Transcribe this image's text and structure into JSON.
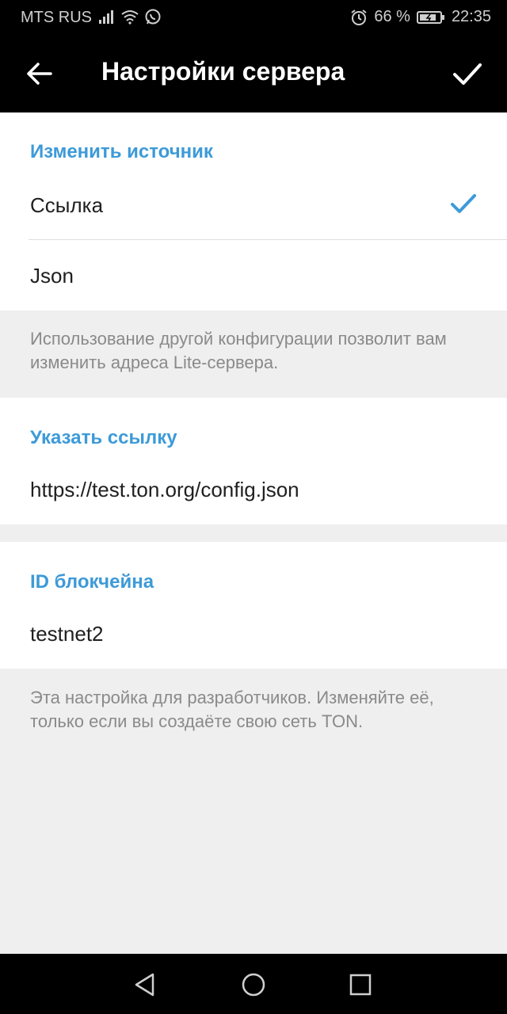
{
  "status_bar": {
    "carrier": "MTS RUS",
    "battery": "66 %",
    "time": "22:35",
    "icons": [
      "signal-icon",
      "wifi-icon",
      "whatsapp-icon",
      "alarm-icon",
      "battery-icon"
    ]
  },
  "toolbar": {
    "title": "Настройки сервера",
    "back_icon": "arrow-left-icon",
    "done_icon": "checkmark-icon"
  },
  "source": {
    "header": "Изменить источник",
    "options": [
      "Ссылка",
      "Json"
    ],
    "selected": "Ссылка",
    "hint": "Использование другой конфигурации позволит вам изменить адреса Lite-сервера."
  },
  "link": {
    "header": "Указать ссылку",
    "value": "https://test.ton.org/config.json"
  },
  "blockchain": {
    "header": "ID блокчейна",
    "value": "testnet2",
    "hint": "Эта настройка для разработчиков. Изменяйте её, только если вы создаёте свою сеть TON."
  },
  "colors": {
    "accent": "#3d9ad8",
    "toolbar_bg": "#000000",
    "background": "#efefef"
  }
}
